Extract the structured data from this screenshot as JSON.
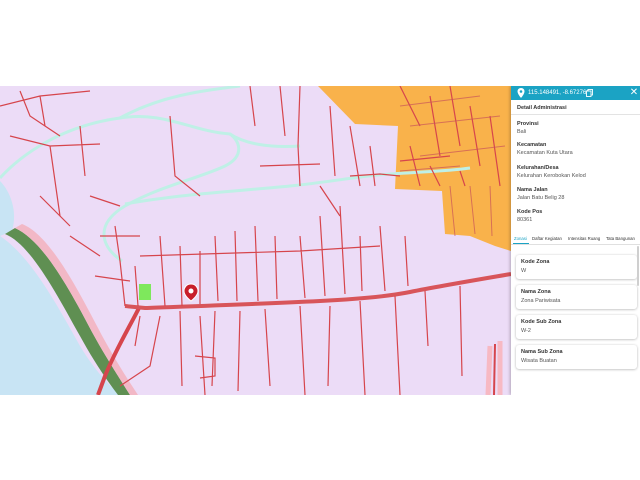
{
  "panel": {
    "coordinates": "115.148491, -8.672761",
    "copy_icon": "copy-icon",
    "close_icon": "close-icon",
    "close_glyph": "✕",
    "section_title": "Detail Administrasi",
    "fields": [
      {
        "label": "Provinsi",
        "value": "Bali"
      },
      {
        "label": "Kecamatan",
        "value": "Kecamatan Kuta Utara"
      },
      {
        "label": "Kelurahan/Desa",
        "value": "Kelurahan Kerobokan Kelod"
      },
      {
        "label": "Nama Jalan",
        "value": "Jalan Batu Belig 28"
      },
      {
        "label": "Kode Pos",
        "value": "80361"
      }
    ],
    "tabs": [
      {
        "label": "Zonasi",
        "active": true
      },
      {
        "label": "Daftar Kegiatan",
        "active": false
      },
      {
        "label": "Intensitas Ruang",
        "active": false
      },
      {
        "label": "Tata Bangunan",
        "active": false
      }
    ],
    "cards": [
      {
        "label": "Kode Zona",
        "value": "W"
      },
      {
        "label": "Nama Zona",
        "value": "Zona Pariwisata"
      },
      {
        "label": "Kode Sub Zona",
        "value": "W-2"
      },
      {
        "label": "Nama Sub Zona",
        "value": "Wisata Buatan"
      }
    ]
  },
  "map": {
    "marker_icon": "location-marker-icon",
    "colors": {
      "land": "#ecdcf7",
      "sea": "#c8e4f4",
      "orange_zone": "#f9b24b",
      "green_strip": "#5f8f52",
      "green_parcel": "#7ee85c",
      "river": "#bff0e6",
      "road": "#d6454c",
      "main_road": "#d8555a",
      "accent": "#1ba3c4"
    }
  }
}
